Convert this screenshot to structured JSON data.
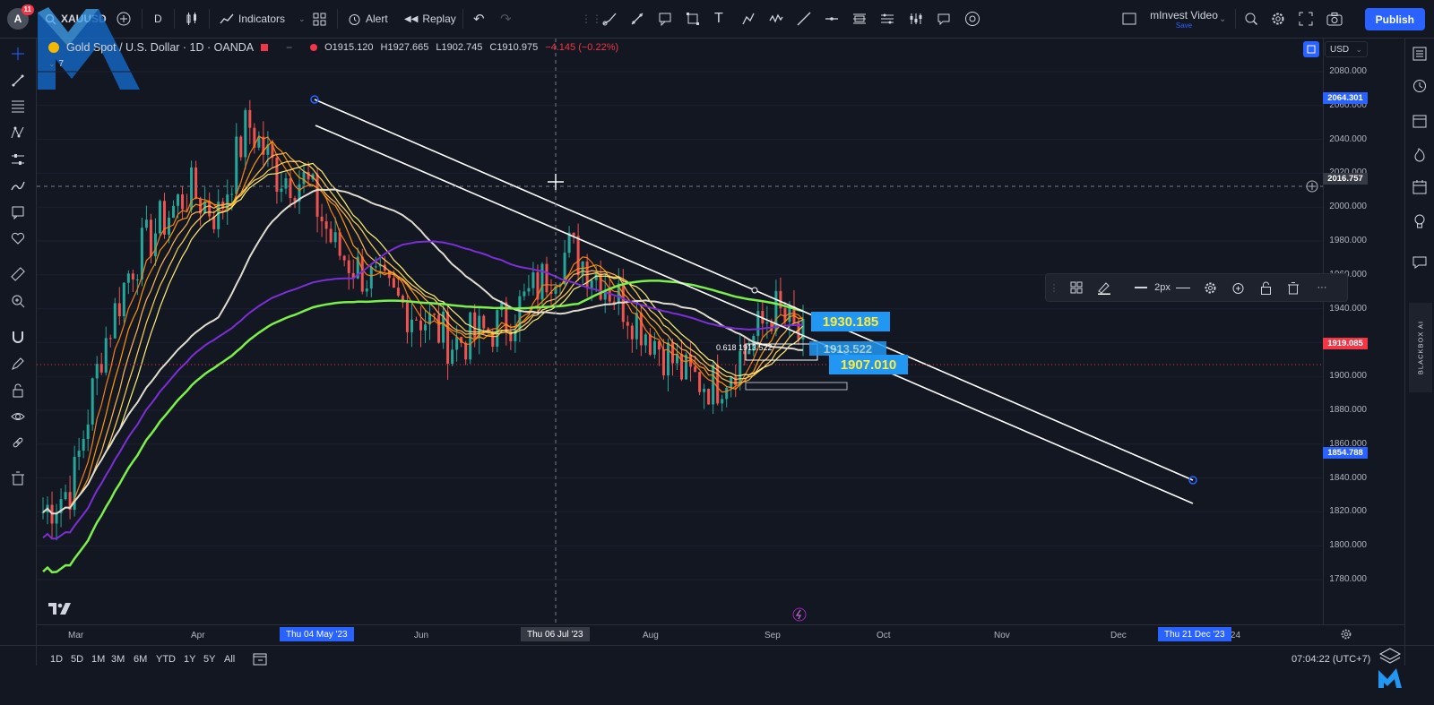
{
  "topbar": {
    "avatar_letter": "A",
    "notif_count": "11",
    "symbol": "XAUUSD",
    "interval": "D",
    "indicators_label": "Indicators",
    "alert_label": "Alert",
    "replay_label": "Replay",
    "layout_name": "mInvest Video",
    "layout_status": "Save",
    "publish_label": "Publish"
  },
  "legend": {
    "title": "Gold Spot / U.S. Dollar · 1D · OANDA",
    "open": "O1915.120",
    "high": "H1927.665",
    "low": "L1902.745",
    "close": "C1910.975",
    "change": "−4.145 (−0.22%)",
    "indicator_count": "7"
  },
  "currency": "USD",
  "price_axis": {
    "labels": [
      "2080.000",
      "2060.000",
      "2040.000",
      "2020.000",
      "2000.000",
      "1980.000",
      "1960.000",
      "1940.000",
      "1920.000",
      "1900.000",
      "1880.000",
      "1860.000",
      "1840.000",
      "1820.000",
      "1800.000",
      "1780.000"
    ],
    "tags": [
      {
        "value": "2064.301",
        "color": "#2962ff"
      },
      {
        "value": "2016.757",
        "color": "#363a45"
      },
      {
        "value": "1919.085",
        "color": "#f23645"
      },
      {
        "value": "1854.788",
        "color": "#2962ff"
      }
    ]
  },
  "time_axis": {
    "labels": [
      "Mar",
      "Apr",
      "Jun",
      "Aug",
      "Sep",
      "Oct",
      "Nov",
      "Dec",
      "'24"
    ],
    "highlights": [
      "Thu 04 May '23",
      "Thu 06 Jul '23",
      "Thu 21 Dec '23"
    ]
  },
  "drawing_labels": {
    "upper": "1930.185",
    "middle": "1913.522",
    "lower": "1907.010",
    "fib": "0.618 1913.522"
  },
  "floating_toolbar": {
    "width_label": "2px"
  },
  "bottombar": {
    "ranges": [
      "1D",
      "5D",
      "1M",
      "3M",
      "6M",
      "YTD",
      "1Y",
      "5Y",
      "All"
    ],
    "clock": "07:04:22 (UTC+7)"
  },
  "sidebar_vertical_label": "BLACKBOX AI",
  "colors": {
    "background": "#131722",
    "up": "#26a69a",
    "down": "#ef5350",
    "accent": "#2962ff",
    "ma200": "#7cf04a",
    "ma100": "#7b2fd6",
    "ma50": "#e0ddd0"
  },
  "chart_data": {
    "type": "candlestick",
    "symbol": "XAUUSD",
    "timeframe": "1D",
    "ylim": [
      1770,
      2090
    ],
    "x": [
      "Mar",
      "Apr",
      "May",
      "Jun",
      "Jul",
      "Aug",
      "Sep"
    ],
    "close_path": [
      1820,
      1835,
      1915,
      1965,
      1990,
      2010,
      1995,
      2050,
      2020,
      2015,
      1975,
      1960,
      1945,
      1935,
      1920,
      1925,
      1935,
      1955,
      1975,
      1960,
      1940,
      1920,
      1900,
      1895,
      1915,
      1940,
      1920
    ],
    "trendlines": [
      {
        "from": [
          "Thu 04 May '23",
          2064.301
        ],
        "to": [
          "Thu 21 Dec '23",
          1854.788
        ]
      },
      {
        "from": [
          "May",
          2055
        ],
        "to": [
          "Dec",
          1842
        ]
      }
    ]
  }
}
